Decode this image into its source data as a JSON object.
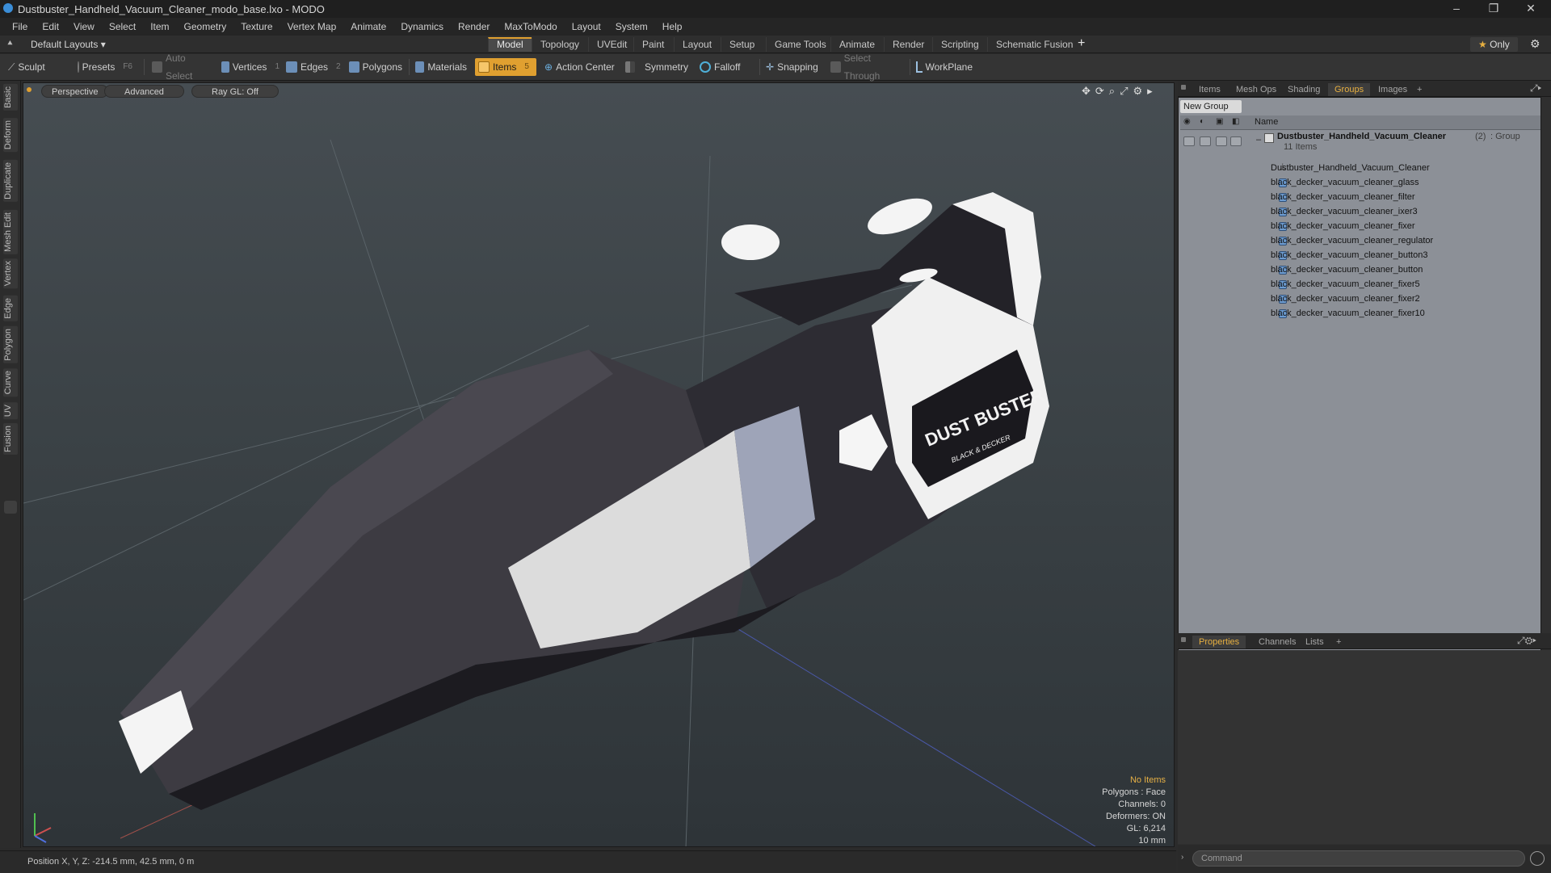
{
  "window": {
    "title": "Dustbuster_Handheld_Vacuum_Cleaner_modo_base.lxo - MODO",
    "min": "–",
    "restore": "❐",
    "close": "✕"
  },
  "menu": [
    "File",
    "Edit",
    "View",
    "Select",
    "Item",
    "Geometry",
    "Texture",
    "Vertex Map",
    "Animate",
    "Dynamics",
    "Render",
    "MaxToModo",
    "Layout",
    "System",
    "Help"
  ],
  "layout": {
    "name": "Default Layouts ▾",
    "tabs": [
      "Model",
      "Topology",
      "UVEdit",
      "Paint",
      "Layout",
      "Setup",
      "Game Tools",
      "Animate",
      "Render",
      "Scripting",
      "Schematic Fusion"
    ],
    "active": "Model",
    "add": "+",
    "only": "Only"
  },
  "toolbar": {
    "sculpt": "Sculpt",
    "presets": "Presets",
    "presets_key": "F6",
    "auto_select": "Auto Select",
    "vertices": "Vertices",
    "vertices_count": "1",
    "edges": "Edges",
    "edges_count": "2",
    "polygons": "Polygons",
    "materials": "Materials",
    "items": "Items",
    "items_count": "5",
    "action_center": "Action Center",
    "symmetry": "Symmetry",
    "falloff": "Falloff",
    "snapping": "Snapping",
    "select_through": "Select Through",
    "workplane": "WorkPlane"
  },
  "left_tabs": [
    "Basic",
    "Deform",
    "Duplicate",
    "Mesh Edit",
    "Vertex",
    "Edge",
    "Polygon",
    "Curve",
    "UV",
    "Fusion"
  ],
  "viewport": {
    "view": "Perspective",
    "shading": "Advanced",
    "raygl": "Ray GL: Off",
    "logo_main": "DUST BUSTER",
    "logo_sub": "BLACK & DECKER"
  },
  "hud": {
    "no_items": "No Items",
    "polygons": "Polygons : Face",
    "channels": "Channels: 0",
    "deformers": "Deformers: ON",
    "gl": "GL: 6,214",
    "scale": "10 mm"
  },
  "status": {
    "position": "Position X, Y, Z:  -214.5 mm, 42.5 mm, 0 m"
  },
  "right_tabs": [
    "Items",
    "Mesh Ops",
    "Shading",
    "Groups",
    "Images",
    "+"
  ],
  "right_active": "Groups",
  "groups": {
    "new_group": "New Group",
    "name_col": "Name",
    "root": "Dustbuster_Handheld_Vacuum_Cleaner",
    "root_count": "(2)",
    "root_type": ": Group",
    "root_items": "11 Items",
    "items": [
      "Dustbuster_Handheld_Vacuum_Cleaner",
      "black_decker_vacuum_cleaner_glass",
      "black_decker_vacuum_cleaner_filter",
      "black_decker_vacuum_cleaner_ixer3",
      "black_decker_vacuum_cleaner_fixer",
      "black_decker_vacuum_cleaner_regulator",
      "black_decker_vacuum_cleaner_button3",
      "black_decker_vacuum_cleaner_button",
      "black_decker_vacuum_cleaner_fixer5",
      "black_decker_vacuum_cleaner_fixer2",
      "black_decker_vacuum_cleaner_fixer10"
    ]
  },
  "bottom_tabs": [
    "Properties",
    "Channels",
    "Lists",
    "+"
  ],
  "bottom_active": "Properties",
  "command": {
    "placeholder": "Command"
  },
  "colors": {
    "accent": "#e0a030",
    "viewport_top": "#464d52",
    "viewport_bottom": "#2e3438",
    "list_bg": "#8c9097"
  }
}
